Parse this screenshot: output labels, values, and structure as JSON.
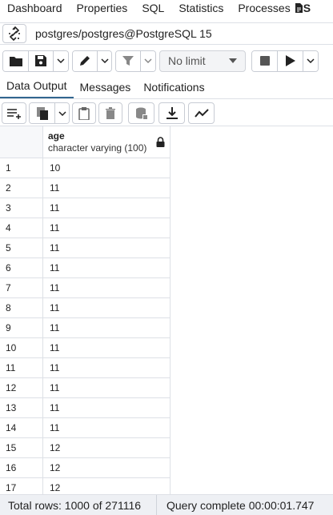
{
  "topnav": {
    "tabs": [
      "Dashboard",
      "Properties",
      "SQL",
      "Statistics",
      "Processes"
    ],
    "query_tool_label": "S"
  },
  "connection": {
    "label": "postgres/postgres@PostgreSQL 15"
  },
  "toolbar": {
    "limit_label": "No limit"
  },
  "result_tabs": [
    "Data Output",
    "Messages",
    "Notifications"
  ],
  "grid": {
    "column": {
      "name": "age",
      "type": "character varying (100)"
    },
    "rows": [
      {
        "n": "1",
        "v": "10"
      },
      {
        "n": "2",
        "v": "11"
      },
      {
        "n": "3",
        "v": "11"
      },
      {
        "n": "4",
        "v": "11"
      },
      {
        "n": "5",
        "v": "11"
      },
      {
        "n": "6",
        "v": "11"
      },
      {
        "n": "7",
        "v": "11"
      },
      {
        "n": "8",
        "v": "11"
      },
      {
        "n": "9",
        "v": "11"
      },
      {
        "n": "10",
        "v": "11"
      },
      {
        "n": "11",
        "v": "11"
      },
      {
        "n": "12",
        "v": "11"
      },
      {
        "n": "13",
        "v": "11"
      },
      {
        "n": "14",
        "v": "11"
      },
      {
        "n": "15",
        "v": "12"
      },
      {
        "n": "16",
        "v": "12"
      },
      {
        "n": "17",
        "v": "12"
      }
    ]
  },
  "status": {
    "total_rows": "Total rows: 1000 of 271116",
    "query_time": "Query complete 00:00:01.747"
  }
}
